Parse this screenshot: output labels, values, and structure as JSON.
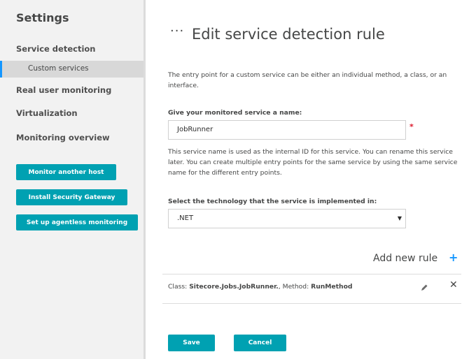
{
  "sidebar": {
    "title": "Settings",
    "items": [
      {
        "label": "Service detection"
      },
      {
        "label": "Custom services"
      },
      {
        "label": "Real user monitoring"
      },
      {
        "label": "Virtualization"
      },
      {
        "label": "Monitoring overview"
      }
    ],
    "buttons": [
      {
        "label": "Monitor another host"
      },
      {
        "label": "Install Security Gateway"
      },
      {
        "label": "Set up agentless monitoring"
      }
    ]
  },
  "main": {
    "title_dots": "···",
    "title": "Edit service detection rule",
    "description": "The entry point for a custom service can be either an individual method, a class, or an interface.",
    "name_label": "Give your monitored service a name:",
    "name_value": "JobRunner",
    "required_mark": "*",
    "name_help": "This service name is used as the internal ID for this service. You can rename this service later. You can create multiple entry points for the same service by using the same service name for the different entry points.",
    "tech_label": "Select the technology that the service is implemented in:",
    "tech_value": ".NET",
    "add_rule_label": "Add new rule",
    "add_rule_icon": "+",
    "rule": {
      "class_prefix": "Class: ",
      "class_value": "Sitecore.Jobs.JobRunner.",
      "method_prefix": ", Method: ",
      "method_value": "RunMethod"
    },
    "save_label": "Save",
    "cancel_label": "Cancel"
  },
  "colors": {
    "accent": "#1496ff",
    "button": "#00a1b2",
    "required": "#dc172a"
  }
}
